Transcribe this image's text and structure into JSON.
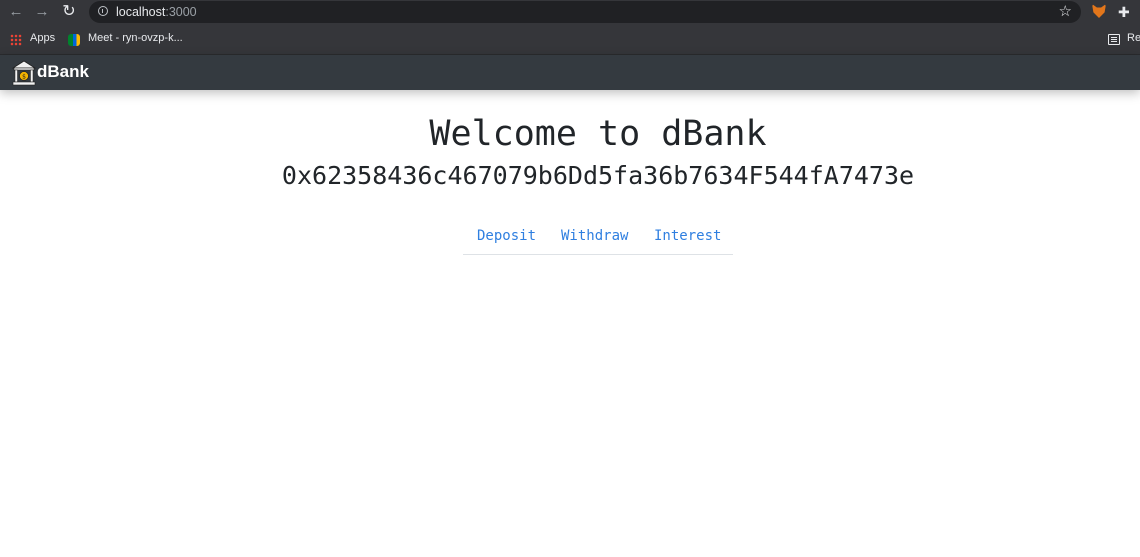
{
  "browser": {
    "url_host": "localhost",
    "url_port": ":3000",
    "bookmarks": [
      {
        "label": "Apps"
      },
      {
        "label": "Meet - ryn-ovzp-k..."
      }
    ],
    "reading_list_label": "Re"
  },
  "app": {
    "brand": "dBank",
    "title": "Welcome to dBank",
    "account_address": "0x62358436c467079b6Dd5fa36b7634F544fA7473e",
    "tabs": [
      {
        "label": "Deposit"
      },
      {
        "label": "Withdraw"
      },
      {
        "label": "Interest"
      }
    ]
  },
  "colors": {
    "navbar": "#343a40",
    "tab_link": "#2f7fe0",
    "browser_chrome": "#35363a"
  }
}
